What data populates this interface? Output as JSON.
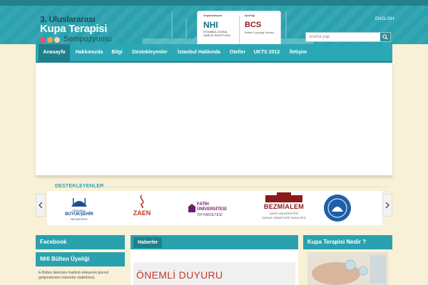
{
  "header": {
    "logo": {
      "line1": "3. Uluslararası",
      "line2": "Kupa Terapisi",
      "line3": "Sempozyumu",
      "dot_colors": [
        "#e84f7a",
        "#f2a34e",
        "#f4d3b5"
      ]
    },
    "organizer_caption": "Organizasyon",
    "organizer_name": "NHI",
    "organizer_sub": "İSTANBUL DOĞAL SAĞLIK ENSTİTÜSÜ",
    "partner_caption": "İşbirliği",
    "partner_name": "BCS",
    "partner_sub": "British Cupping Society",
    "lang_label": "ENGLISH",
    "search_placeholder": "Arama yap",
    "search_icon": "search-icon"
  },
  "nav": {
    "items": [
      {
        "label": "Anasayfa",
        "active": true
      },
      {
        "label": "Hakkımızda",
        "active": false
      },
      {
        "label": "Bilgi",
        "active": false
      },
      {
        "label": "Destekleyenler",
        "active": false
      },
      {
        "label": "İstanbul Hakkında",
        "active": false
      },
      {
        "label": "Oteller",
        "active": false
      },
      {
        "label": "UKTS 2012",
        "active": false
      },
      {
        "label": "İletişim",
        "active": false
      }
    ]
  },
  "supporters": {
    "title": "DESTEKLEYENLER",
    "logos": [
      {
        "line1": "İSTANBUL",
        "line2": "BÜYÜKŞEHİR",
        "line3": "BELEDİYESİ"
      },
      {
        "line1": "ZAEN"
      },
      {
        "line1": "FATİH",
        "line2": "ÜNİVERSİTESİ",
        "line3": "TIP FAKÜLTESİ"
      },
      {
        "line1": "BEZMİALEM",
        "line2": "VAKIF ÜNİVERSİTESİ",
        "line3": "SAĞLIK HİZMETLERİ FAKÜLTESİ"
      }
    ],
    "prev_icon": "chevron-left-icon",
    "next_icon": "chevron-right-icon"
  },
  "left_col": {
    "facebook_title": "Facebook",
    "bulletin_title": "NHI Bülten Üyeliği",
    "bulletin_text": "E-Bülten listemize mailinizi ekleyerek güncel gelişmelerden haberdar olabilirsiniz."
  },
  "middle_col": {
    "tab_label": "Haberler",
    "headline": "ÖNEMLİ DUYURU"
  },
  "right_col": {
    "title": "Kupa Terapisi Nedir ?"
  },
  "colors": {
    "teal": "#2aa1ae",
    "teal_dark": "#1f7f8a",
    "cream": "#f8f1d7",
    "red": "#c0392b"
  }
}
